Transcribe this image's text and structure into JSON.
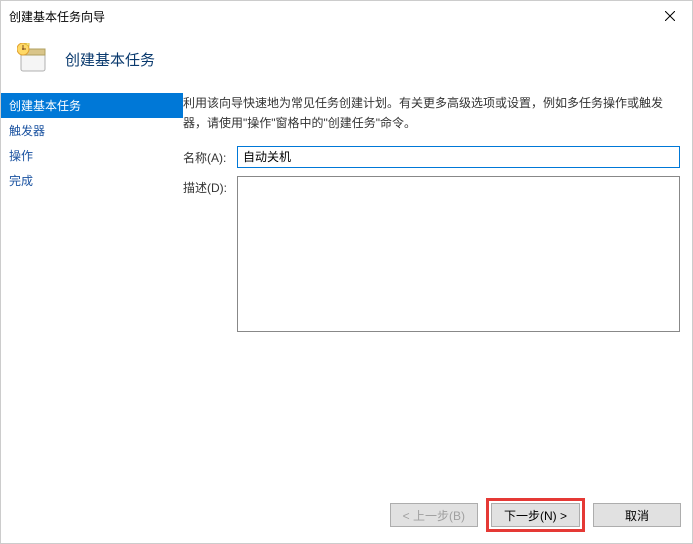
{
  "window": {
    "title": "创建基本任务向导"
  },
  "header": {
    "title": "创建基本任务"
  },
  "sidebar": {
    "items": [
      {
        "label": "创建基本任务",
        "active": true
      },
      {
        "label": "触发器",
        "active": false
      },
      {
        "label": "操作",
        "active": false
      },
      {
        "label": "完成",
        "active": false
      }
    ]
  },
  "main": {
    "intro": "利用该向导快速地为常见任务创建计划。有关更多高级选项或设置，例如多任务操作或触发器，请使用\"操作\"窗格中的\"创建任务\"命令。",
    "name_label": "名称(A):",
    "name_value": "自动关机",
    "desc_label": "描述(D):",
    "desc_value": ""
  },
  "footer": {
    "back": "< 上一步(B)",
    "next": "下一步(N) >",
    "cancel": "取消"
  }
}
